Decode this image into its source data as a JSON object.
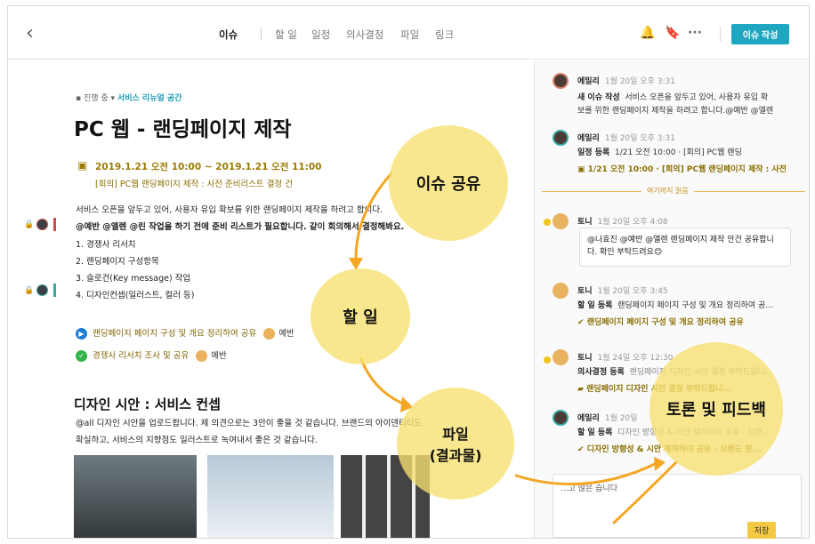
{
  "topbar": {
    "tabs": [
      "이슈",
      "할 일",
      "일정",
      "의사결정",
      "파일",
      "링크"
    ],
    "write_label": "이슈 작성"
  },
  "issue": {
    "status": "진행 중",
    "space": "서비스 리뉴얼 공간",
    "title": "PC 웹 - 랜딩페이지 제작",
    "date": "2019.1.21 오전 10:00  ~  2019.1.21 오전 11:00",
    "meeting": "[회의] PC웹 랜딩페이지 제작 : 사전 준비리스트 결정 건",
    "body": [
      "서비스 오픈을 앞두고 있어, 사용자 유입 확보를 위한 랜딩페이지 제작을 하려고 합니다.",
      "@예반 @엘렌 @린 작업을 하기 전에 준비 리스트가 필요합니다. 같이 회의해서 결정해봐요.",
      "1. 경쟁사 리서치",
      "2. 랜딩페이지 구성항목",
      "3. 슬로건(Key message) 작업",
      "4. 디자인컨셉(일러스트, 컬러 등)"
    ],
    "todos": [
      {
        "text": "랜딩페이지 페이지 구성 및 개요 정리하여 공유",
        "who": "예반"
      },
      {
        "text": "경쟁사 리서치 조사 및 공유",
        "who": "예반"
      }
    ],
    "section_title": "디자인 시안 : 서비스 컨셉",
    "section_body": [
      "@all 디자인 시안을 업로드합니다. 제 의견으로는 3안이 좋을 것 같습니다. 브랜드의 아이덴티티도",
      "확실하고, 서비스의 지향점도 일러스트로 녹여내서 좋은 것 같습니다."
    ]
  },
  "feed": {
    "items": [
      {
        "name": "에밀리",
        "time": "1월 20일 오후 3:31",
        "label": "새 이슈 작성",
        "text": "서비스 오픈을 앞두고 있어, 사용자 유입 확",
        "text2": "보를 위한 랜딩페이지 제작을 하려고 합니다.@예반 @엘렌"
      },
      {
        "name": "에밀리",
        "time": "1월 20일 오후 3:31",
        "label": "일정 등록",
        "text": "1/21 오전 10:00 · [회의] PC웹 랜딩",
        "text2": "1/21 오전 10:00 · [회의] PC웹 랜딩페이지 제작 : 사전"
      },
      {
        "name": "토니",
        "time": "1월 20일 오후 4:08",
        "text": "@나효진 @예반 @엘렌 랜딩페이지 제작 안건 공유합니",
        "text2": "다. 확인 부탁드려요😊"
      },
      {
        "name": "토니",
        "time": "1월 20일 오후 3:45",
        "label": "할 일 등록",
        "text": "랜딩페이지 페이지 구성 및 개요 정리하여 공...",
        "text2": "랜딩페이지 페이지 구성 및 개요 정리하여 공유"
      },
      {
        "name": "토니",
        "time": "1월 24일 오후 12:30",
        "label": "의사결정 등록",
        "text": "랜딩페이지 디자인 시안 결정 부탁드립니...",
        "text2": "랜딩페이지 디자인 시안 결정 부탁드립니..."
      },
      {
        "name": "에밀리",
        "time": "1월 20일",
        "label": "할 일 등록",
        "text": "디자인 방향성 & 시안 제작하여 공유 - 브랜...",
        "text2": "디자인 방향성 & 시안 제작하여 공유 - 브랜드 정..."
      }
    ],
    "divider": "여기까지 읽음",
    "comment": "...고 많은 습니다",
    "save_label": "저장"
  },
  "annotations": [
    "이슈 공유",
    "할 일",
    "파일\n(결과물)",
    "토론 및 피드백"
  ]
}
